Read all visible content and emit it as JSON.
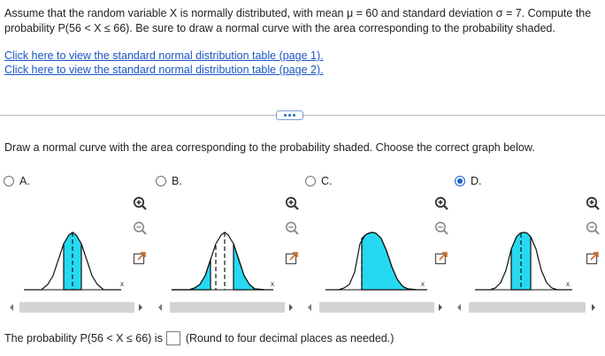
{
  "question": {
    "text": "Assume that the random variable X is normally distributed, with mean μ = 60 and standard deviation σ = 7. Compute the probability P(56 < X ≤ 66). Be sure to draw a normal curve with the area corresponding to the probability shaded."
  },
  "links": [
    {
      "label": "Click here to view the standard normal distribution table (page 1)."
    },
    {
      "label": "Click here to view the standard normal distribution table (page 2)."
    }
  ],
  "instruction": "Draw a normal curve with the area corresponding to the probability shaded. Choose the correct graph below.",
  "options": [
    {
      "label": "A.",
      "selected": false,
      "axis_label": "x",
      "shade": "between"
    },
    {
      "label": "B.",
      "selected": false,
      "axis_label": "x",
      "shade": "tails"
    },
    {
      "label": "C.",
      "selected": false,
      "axis_label": "x",
      "shade": "right"
    },
    {
      "label": "D.",
      "selected": true,
      "axis_label": "x",
      "shade": "between"
    }
  ],
  "answer": {
    "prefix": "The probability P(56 < X ≤ 66) is",
    "value": "",
    "note": "(Round to four decimal places as needed.)"
  },
  "colors": {
    "shade": "#26d9f2",
    "link": "#1a56c4",
    "selected": "#1a63d8"
  },
  "icons": [
    "zoom-in-icon",
    "zoom-out-icon",
    "popout-icon",
    "more-icon"
  ]
}
